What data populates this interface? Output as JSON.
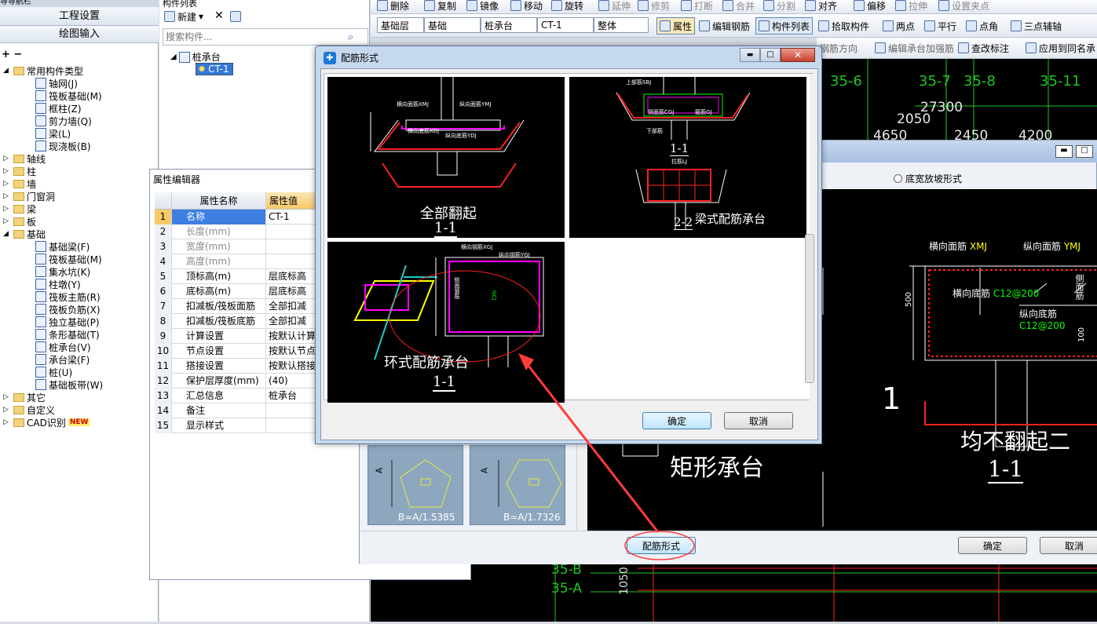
{
  "nav_panel": {
    "title": "导导航栏",
    "btn1": "工程设置",
    "btn2": "绘图输入"
  },
  "tree": [
    {
      "label": "常用构件类型",
      "level": 0,
      "expanded": true
    },
    {
      "label": "轴网(J)",
      "level": 1
    },
    {
      "label": "筏板基础(M)",
      "level": 1
    },
    {
      "label": "框柱(Z)",
      "level": 1
    },
    {
      "label": "剪力墙(Q)",
      "level": 1
    },
    {
      "label": "梁(L)",
      "level": 1
    },
    {
      "label": "现浇板(B)",
      "level": 1
    },
    {
      "label": "轴线",
      "level": 0
    },
    {
      "label": "柱",
      "level": 0
    },
    {
      "label": "墙",
      "level": 0
    },
    {
      "label": "门窗洞",
      "level": 0
    },
    {
      "label": "梁",
      "level": 0
    },
    {
      "label": "板",
      "level": 0
    },
    {
      "label": "基础",
      "level": 0,
      "expanded": true
    },
    {
      "label": "基础梁(F)",
      "level": 1
    },
    {
      "label": "筏板基础(M)",
      "level": 1
    },
    {
      "label": "集水坑(K)",
      "level": 1
    },
    {
      "label": "柱墩(Y)",
      "level": 1
    },
    {
      "label": "筏板主筋(R)",
      "level": 1
    },
    {
      "label": "筏板负筋(X)",
      "level": 1
    },
    {
      "label": "独立基础(P)",
      "level": 1
    },
    {
      "label": "条形基础(T)",
      "level": 1
    },
    {
      "label": "桩承台(V)",
      "level": 1
    },
    {
      "label": "承台梁(F)",
      "level": 1
    },
    {
      "label": "桩(U)",
      "level": 1
    },
    {
      "label": "基础板带(W)",
      "level": 1
    },
    {
      "label": "其它",
      "level": 0
    },
    {
      "label": "自定义",
      "level": 0
    },
    {
      "label": "CAD识别",
      "level": 0,
      "badge": "NEW"
    }
  ],
  "component_list": {
    "title": "构件列表",
    "new_label": "新建",
    "search_placeholder": "搜索构件...",
    "root": "桩承台",
    "child": "CT-1"
  },
  "top_toolbar": {
    "items": [
      "删除",
      "复制",
      "镜像",
      "移动",
      "旋转",
      "延伸",
      "修剪",
      "打断",
      "合并",
      "分割",
      "对齐",
      "偏移",
      "拉伸",
      "设置夹点"
    ]
  },
  "second_toolbar": {
    "floor": "基础层",
    "category": "基础",
    "type": "桩承台",
    "name": "CT-1",
    "scope": "整体",
    "items": [
      "属性",
      "编辑钢筋",
      "构件列表",
      "拾取构件",
      "两点",
      "平行",
      "点角",
      "三点辅轴"
    ]
  },
  "third_toolbar": {
    "items": [
      "钢筋方向",
      "编辑承台加强筋",
      "查改标注",
      "应用到同名承"
    ]
  },
  "property_editor": {
    "title": "属性编辑器",
    "header": [
      "属性名称",
      "属性值"
    ],
    "rows": [
      {
        "no": "1",
        "name": "名称",
        "value": "CT-1"
      },
      {
        "no": "2",
        "name": "长度(mm)",
        "value": ""
      },
      {
        "no": "3",
        "name": "宽度(mm)",
        "value": ""
      },
      {
        "no": "4",
        "name": "高度(mm)",
        "value": ""
      },
      {
        "no": "5",
        "name": "顶标高(m)",
        "value": "层底标高"
      },
      {
        "no": "6",
        "name": "底标高(m)",
        "value": "层底标高"
      },
      {
        "no": "7",
        "name": "扣减板/筏板面筋",
        "value": "全部扣减"
      },
      {
        "no": "8",
        "name": "扣减板/筏板底筋",
        "value": "全部扣减"
      },
      {
        "no": "9",
        "name": "计算设置",
        "value": "按默认计算"
      },
      {
        "no": "10",
        "name": "节点设置",
        "value": "按默认节点"
      },
      {
        "no": "11",
        "name": "搭接设置",
        "value": "按默认搭接"
      },
      {
        "no": "12",
        "name": "保护层厚度(mm)",
        "value": "(40)"
      },
      {
        "no": "13",
        "name": "汇总信息",
        "value": "桩承台"
      },
      {
        "no": "14",
        "name": "备注",
        "value": ""
      },
      {
        "no": "15",
        "name": "显示样式",
        "value": ""
      }
    ]
  },
  "cad_top": {
    "axes": [
      "35-6",
      "35-7",
      "35-8",
      "35-11"
    ],
    "dims": [
      "27300",
      "2050",
      "4650",
      "2450",
      "4200"
    ]
  },
  "cad_bottom": {
    "axes": [
      "35-B",
      "35-A"
    ],
    "dim": "1050"
  },
  "back_dialog": {
    "option": "底宽放坡形式",
    "title_big": "矩形承台",
    "section": "1",
    "right_title": "均不翻起二",
    "right_sub": "1-1",
    "label_top_left": "横向面筋",
    "label_top_left_code": "XMJ",
    "label_top_right": "纵向面筋",
    "label_top_right_code": "YMJ",
    "label_mid": "横向底筋",
    "label_mid_code": "C12@200",
    "label_low": "纵向底筋",
    "label_low_code": "C12@200",
    "label_side": "侧面筋",
    "dim_left": "500",
    "dim_small": "100",
    "shape1": "B=A/1.5385",
    "shape2": "B=A/1.7326",
    "shape_axis": "A",
    "btn_peijin": "配筋形式",
    "btn_ok": "确定",
    "btn_cancel": "取消"
  },
  "front_dialog": {
    "title": "配筋形式",
    "cells": [
      {
        "title": "全部翻起",
        "sub": "1-1"
      },
      {
        "title": "梁式配筋承台",
        "sub1": "1-1",
        "sub2": "2-2"
      },
      {
        "title": "环式配筋承台",
        "sub": "1-1"
      }
    ],
    "annotations": {
      "c1": [
        "横向面筋XMJ",
        "纵向面筋YMJ",
        "横向底筋XDJ",
        "纵向底筋YDJ"
      ],
      "c2": [
        "上部筋SBJ",
        "侧面筋CGJ",
        "箍筋GJ",
        "下部筋",
        "拉筋LJ"
      ],
      "c3": [
        "横向钢筋XGJ",
        "纵向钢筋YGJ",
        "侧面钢筋",
        "GCJ"
      ]
    },
    "btn_ok": "确定",
    "btn_cancel": "取消"
  },
  "colors": {
    "highlight": "#ff3b3b",
    "cad_green": "#1fc61f",
    "cad_red": "#ff2020",
    "cad_magenta": "#ff00ff"
  }
}
